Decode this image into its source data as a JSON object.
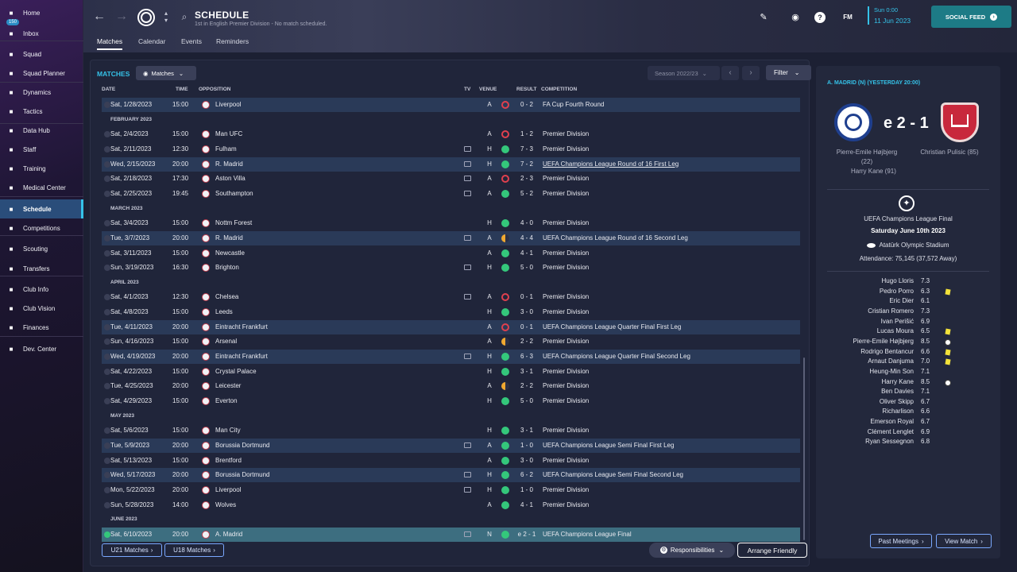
{
  "sidebar": {
    "items": [
      {
        "label": "Home",
        "icon": "home-icon"
      },
      {
        "label": "Inbox",
        "icon": "inbox-icon",
        "badge": "150"
      },
      {
        "label": "Squad",
        "icon": "shirt-icon"
      },
      {
        "label": "Squad Planner",
        "icon": "planner-icon"
      },
      {
        "label": "Dynamics",
        "icon": "dynamics-icon"
      },
      {
        "label": "Tactics",
        "icon": "tactics-icon"
      },
      {
        "label": "Data Hub",
        "icon": "data-hub-icon"
      },
      {
        "label": "Staff",
        "icon": "staff-icon"
      },
      {
        "label": "Training",
        "icon": "training-icon"
      },
      {
        "label": "Medical Center",
        "icon": "medical-icon"
      },
      {
        "label": "Schedule",
        "icon": "calendar-icon",
        "active": true
      },
      {
        "label": "Competitions",
        "icon": "trophy-icon"
      },
      {
        "label": "Scouting",
        "icon": "scouting-icon"
      },
      {
        "label": "Transfers",
        "icon": "transfers-icon"
      },
      {
        "label": "Club Info",
        "icon": "club-info-icon"
      },
      {
        "label": "Club Vision",
        "icon": "club-vision-icon"
      },
      {
        "label": "Finances",
        "icon": "finances-icon"
      },
      {
        "label": "Dev. Center",
        "icon": "dev-center-icon"
      }
    ]
  },
  "header": {
    "title": "SCHEDULE",
    "subtitle": "1st in English Premier Division - No match scheduled.",
    "tabs": [
      "Matches",
      "Calendar",
      "Events",
      "Reminders"
    ],
    "date_line1": "Sun 0:00",
    "date_line2": "11 Jun 2023",
    "fm_label": "FM",
    "social_feed": "SOCIAL FEED"
  },
  "matches_panel": {
    "title": "MATCHES",
    "view_dropdown": "Matches",
    "season": "Season 2022/23",
    "filter": "Filter",
    "columns": {
      "date": "DATE",
      "time": "TIME",
      "opposition": "OPPOSITION",
      "tv": "TV",
      "venue": "VENUE",
      "result": "RESULT",
      "competition": "COMPETITION"
    },
    "months": [
      "FEBRUARY 2023",
      "MARCH 2023",
      "APRIL 2023",
      "MAY 2023",
      "JUNE 2023"
    ],
    "rows": [
      {
        "date": "Sat, 1/28/2023",
        "time": "15:00",
        "opp": "Liverpool",
        "tv": false,
        "venue": "A",
        "res": "L",
        "score": "0 - 2",
        "comp": "FA Cup Fourth Round",
        "alt": true
      },
      {
        "date": "Sat, 2/4/2023",
        "time": "15:00",
        "opp": "Man UFC",
        "tv": false,
        "venue": "A",
        "res": "L",
        "score": "1 - 2",
        "comp": "Premier Division"
      },
      {
        "date": "Sat, 2/11/2023",
        "time": "12:30",
        "opp": "Fulham",
        "tv": true,
        "venue": "H",
        "res": "W",
        "score": "7 - 3",
        "comp": "Premier Division"
      },
      {
        "date": "Wed, 2/15/2023",
        "time": "20:00",
        "opp": "R. Madrid",
        "tv": true,
        "venue": "H",
        "res": "W",
        "score": "7 - 2",
        "comp": "UEFA Champions League Round of 16 First Leg",
        "alt": true,
        "underline": true
      },
      {
        "date": "Sat, 2/18/2023",
        "time": "17:30",
        "opp": "Aston Villa",
        "tv": true,
        "venue": "A",
        "res": "L",
        "score": "2 - 3",
        "comp": "Premier Division"
      },
      {
        "date": "Sat, 2/25/2023",
        "time": "19:45",
        "opp": "Southampton",
        "tv": true,
        "venue": "A",
        "res": "W",
        "score": "5 - 2",
        "comp": "Premier Division"
      },
      {
        "date": "Sat, 3/4/2023",
        "time": "15:00",
        "opp": "Nottm Forest",
        "tv": false,
        "venue": "H",
        "res": "W",
        "score": "4 - 0",
        "comp": "Premier Division"
      },
      {
        "date": "Tue, 3/7/2023",
        "time": "20:00",
        "opp": "R. Madrid",
        "tv": true,
        "venue": "A",
        "res": "D",
        "score": "4 - 4",
        "comp": "UEFA Champions League Round of 16 Second Leg",
        "alt": true
      },
      {
        "date": "Sat, 3/11/2023",
        "time": "15:00",
        "opp": "Newcastle",
        "tv": false,
        "venue": "A",
        "res": "W",
        "score": "4 - 1",
        "comp": "Premier Division"
      },
      {
        "date": "Sun, 3/19/2023",
        "time": "16:30",
        "opp": "Brighton",
        "tv": true,
        "venue": "H",
        "res": "W",
        "score": "5 - 0",
        "comp": "Premier Division"
      },
      {
        "date": "Sat, 4/1/2023",
        "time": "12:30",
        "opp": "Chelsea",
        "tv": true,
        "venue": "A",
        "res": "L",
        "score": "0 - 1",
        "comp": "Premier Division"
      },
      {
        "date": "Sat, 4/8/2023",
        "time": "15:00",
        "opp": "Leeds",
        "tv": false,
        "venue": "H",
        "res": "W",
        "score": "3 - 0",
        "comp": "Premier Division"
      },
      {
        "date": "Tue, 4/11/2023",
        "time": "20:00",
        "opp": "Eintracht Frankfurt",
        "tv": false,
        "venue": "A",
        "res": "L",
        "score": "0 - 1",
        "comp": "UEFA Champions League Quarter Final First Leg",
        "alt": true
      },
      {
        "date": "Sun, 4/16/2023",
        "time": "15:00",
        "opp": "Arsenal",
        "tv": false,
        "venue": "A",
        "res": "D",
        "score": "2 - 2",
        "comp": "Premier Division"
      },
      {
        "date": "Wed, 4/19/2023",
        "time": "20:00",
        "opp": "Eintracht Frankfurt",
        "tv": true,
        "venue": "H",
        "res": "W",
        "score": "6 - 3",
        "comp": "UEFA Champions League Quarter Final Second Leg",
        "alt": true
      },
      {
        "date": "Sat, 4/22/2023",
        "time": "15:00",
        "opp": "Crystal Palace",
        "tv": false,
        "venue": "H",
        "res": "W",
        "score": "3 - 1",
        "comp": "Premier Division"
      },
      {
        "date": "Tue, 4/25/2023",
        "time": "20:00",
        "opp": "Leicester",
        "tv": false,
        "venue": "A",
        "res": "D",
        "score": "2 - 2",
        "comp": "Premier Division"
      },
      {
        "date": "Sat, 4/29/2023",
        "time": "15:00",
        "opp": "Everton",
        "tv": false,
        "venue": "H",
        "res": "W",
        "score": "5 - 0",
        "comp": "Premier Division"
      },
      {
        "date": "Sat, 5/6/2023",
        "time": "15:00",
        "opp": "Man City",
        "tv": false,
        "venue": "H",
        "res": "W",
        "score": "3 - 1",
        "comp": "Premier Division"
      },
      {
        "date": "Tue, 5/9/2023",
        "time": "20:00",
        "opp": "Borussia Dortmund",
        "tv": true,
        "venue": "A",
        "res": "W",
        "score": "1 - 0",
        "comp": "UEFA Champions League Semi Final First Leg",
        "alt": true
      },
      {
        "date": "Sat, 5/13/2023",
        "time": "15:00",
        "opp": "Brentford",
        "tv": false,
        "venue": "A",
        "res": "W",
        "score": "3 - 0",
        "comp": "Premier Division"
      },
      {
        "date": "Wed, 5/17/2023",
        "time": "20:00",
        "opp": "Borussia Dortmund",
        "tv": true,
        "venue": "H",
        "res": "W",
        "score": "6 - 2",
        "comp": "UEFA Champions League Semi Final Second Leg",
        "alt": true
      },
      {
        "date": "Mon, 5/22/2023",
        "time": "20:00",
        "opp": "Liverpool",
        "tv": true,
        "venue": "H",
        "res": "W",
        "score": "1 - 0",
        "comp": "Premier Division"
      },
      {
        "date": "Sun, 5/28/2023",
        "time": "14:00",
        "opp": "Wolves",
        "tv": false,
        "venue": "A",
        "res": "W",
        "score": "4 - 1",
        "comp": "Premier Division"
      },
      {
        "date": "Sat, 6/10/2023",
        "time": "20:00",
        "opp": "A. Madrid",
        "tv": true,
        "venue": "N",
        "res": "W",
        "score": "e 2 - 1",
        "comp": "UEFA Champions League Final",
        "final": true
      }
    ],
    "footer": {
      "u21": "U21 Matches",
      "u18": "U18 Matches",
      "responsibilities": "Responsibilities",
      "arrange": "Arrange Friendly"
    }
  },
  "detail": {
    "header": "A. MADRID (N) (YESTERDAY 20:00)",
    "score": "e 2 - 1",
    "home_scorers": [
      "Pierre-Emile Højbjerg",
      "(22)",
      "Harry Kane (91)"
    ],
    "away_scorers": [
      "Christian Pulisic (85)"
    ],
    "competition": "UEFA Champions League Final",
    "date": "Saturday June 10th 2023",
    "stadium": "Atatürk Olympic Stadium",
    "attendance": "Attendance: 75,145 (37,572 Away)",
    "players": [
      {
        "name": "Hugo Lloris",
        "rating": "7.3"
      },
      {
        "name": "Pedro Porro",
        "rating": "6.3",
        "yc": true
      },
      {
        "name": "Eric Dier",
        "rating": "6.1"
      },
      {
        "name": "Cristian Romero",
        "rating": "7.3"
      },
      {
        "name": "Ivan Perišić",
        "rating": "6.9"
      },
      {
        "name": "Lucas Moura",
        "rating": "6.5",
        "yc": true
      },
      {
        "name": "Pierre-Emile Højbjerg",
        "rating": "8.5",
        "goal": true
      },
      {
        "name": "Rodrigo Bentancur",
        "rating": "6.6",
        "yc": true
      },
      {
        "name": "Arnaut Danjuma",
        "rating": "7.0",
        "yc": true
      },
      {
        "name": "Heung-Min Son",
        "rating": "7.1"
      },
      {
        "name": "Harry Kane",
        "rating": "8.5",
        "goal": true
      },
      {
        "name": "Ben Davies",
        "rating": "7.1"
      },
      {
        "name": "Oliver Skipp",
        "rating": "6.7"
      },
      {
        "name": "Richarlison",
        "rating": "6.6"
      },
      {
        "name": "Emerson Royal",
        "rating": "6.7"
      },
      {
        "name": "Clément Lenglet",
        "rating": "6.9"
      },
      {
        "name": "Ryan Sessegnon",
        "rating": "6.8"
      }
    ],
    "past_meetings": "Past Meetings",
    "view_match": "View Match"
  }
}
